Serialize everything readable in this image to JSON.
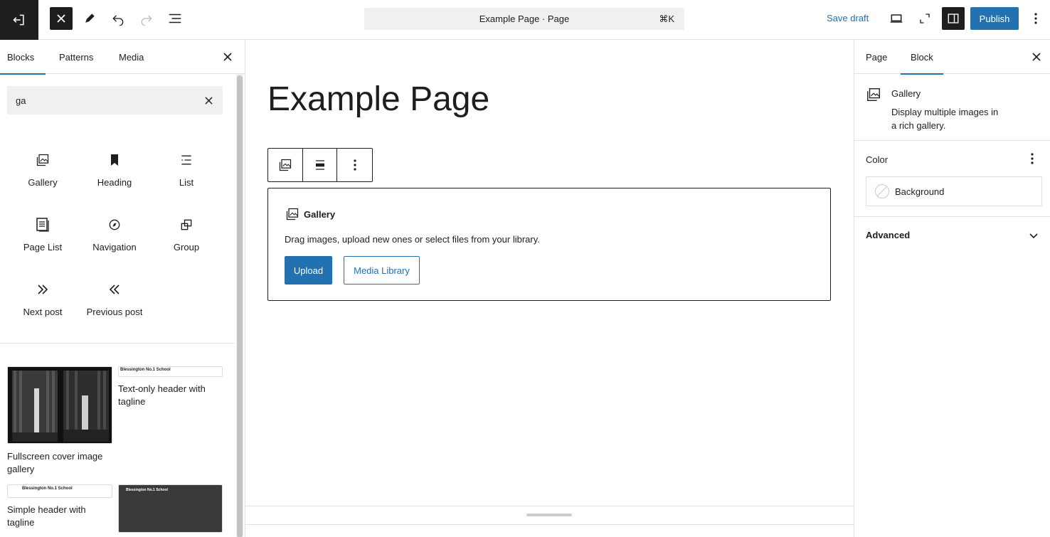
{
  "topbar": {
    "document_title": "Example Page · Page",
    "shortcut": "⌘K",
    "save_draft": "Save draft",
    "publish": "Publish"
  },
  "inserter": {
    "tabs": [
      "Blocks",
      "Patterns",
      "Media"
    ],
    "search_value": "ga",
    "blocks": [
      {
        "label": "Gallery",
        "icon": "gallery-icon"
      },
      {
        "label": "Heading",
        "icon": "bookmark-icon"
      },
      {
        "label": "List",
        "icon": "list-icon"
      },
      {
        "label": "Page List",
        "icon": "page-list-icon"
      },
      {
        "label": "Navigation",
        "icon": "compass-icon"
      },
      {
        "label": "Group",
        "icon": "group-icon"
      },
      {
        "label": "Next post",
        "icon": "chevron-double-right-icon"
      },
      {
        "label": "Previous post",
        "icon": "chevron-double-left-icon"
      }
    ],
    "patterns": [
      {
        "label": "Fullscreen cover image gallery"
      },
      {
        "label": "Text-only header with tagline",
        "thumb_text": "Blessington No.1 School"
      },
      {
        "label": "Simple header with tagline",
        "thumb_text": "Blessington No.1 School"
      },
      {
        "thumb_text": "Blessington No.1 School"
      }
    ]
  },
  "editor": {
    "page_title": "Example Page",
    "gallery_block": {
      "title": "Gallery",
      "instructions": "Drag images, upload new ones or select files from your library.",
      "upload": "Upload",
      "media_library": "Media Library"
    }
  },
  "settings": {
    "tabs": [
      "Page",
      "Block"
    ],
    "block_name": "Gallery",
    "block_description": "Display multiple images in a rich gallery.",
    "color_title": "Color",
    "background_label": "Background",
    "advanced_title": "Advanced"
  },
  "colors": {
    "accent": "#2271b1",
    "dark": "#1e1e1e"
  }
}
